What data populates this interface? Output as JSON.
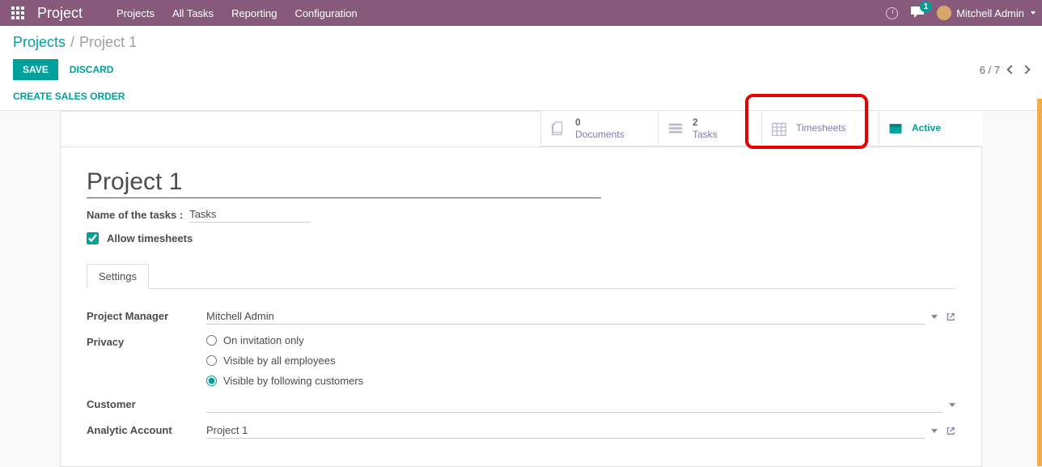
{
  "nav": {
    "brand": "Project",
    "menu": [
      "Projects",
      "All Tasks",
      "Reporting",
      "Configuration"
    ],
    "chat_badge": "1",
    "user": "Mitchell Admin"
  },
  "breadcrumb": {
    "parent": "Projects",
    "sep": "/",
    "current": "Project 1"
  },
  "buttons": {
    "save": "SAVE",
    "discard": "DISCARD",
    "create_so": "CREATE SALES ORDER"
  },
  "pager": {
    "text": "6 / 7"
  },
  "stats": {
    "docs_count": "0",
    "docs_label": "Documents",
    "tasks_count": "2",
    "tasks_label": "Tasks",
    "timesheets": "Timesheets",
    "active": "Active"
  },
  "form": {
    "title": "Project 1",
    "name_label": "Name of the tasks :",
    "name_value": "Tasks",
    "allow_ts": "Allow timesheets",
    "tab_settings": "Settings",
    "pm_label": "Project Manager",
    "pm_value": "Mitchell Admin",
    "privacy_label": "Privacy",
    "privacy_opts": [
      "On invitation only",
      "Visible by all employees",
      "Visible by following customers"
    ],
    "customer_label": "Customer",
    "analytic_label": "Analytic Account",
    "analytic_value": "Project 1"
  }
}
